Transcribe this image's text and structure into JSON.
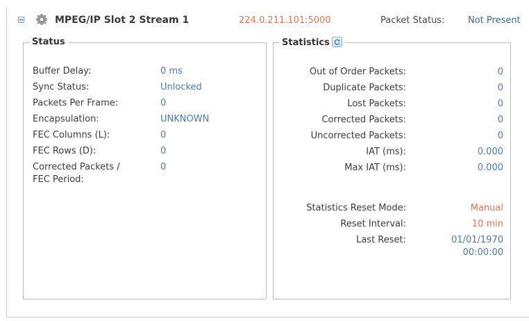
{
  "header": {
    "title": "MPEG/IP Slot 2 Stream 1",
    "address": "224.0.211.101:5000",
    "packet_status_label": "Packet Status:",
    "packet_status_value": "Not Present"
  },
  "status": {
    "legend": "Status",
    "rows": [
      {
        "label": "Buffer Delay:",
        "value": "0 ms"
      },
      {
        "label": "Sync Status:",
        "value": "Unlocked"
      },
      {
        "label": "Packets Per Frame:",
        "value": "0"
      },
      {
        "label": "Encapsulation:",
        "value": "UNKNOWN"
      },
      {
        "label": "FEC Columns (L):",
        "value": "0"
      },
      {
        "label": "FEC Rows (D):",
        "value": "0"
      },
      {
        "label": "Corrected Packets /",
        "label2": "FEC Period:",
        "value": "0"
      }
    ]
  },
  "statistics": {
    "legend": "Statistics",
    "rows": [
      {
        "label": "Out of Order Packets:",
        "value": "0"
      },
      {
        "label": "Duplicate Packets:",
        "value": "0"
      },
      {
        "label": "Lost Packets:",
        "value": "0"
      },
      {
        "label": "Corrected Packets:",
        "value": "0"
      },
      {
        "label": "Uncorrected Packets:",
        "value": "0"
      },
      {
        "label": "IAT (ms):",
        "value": "0.000"
      },
      {
        "label": "Max IAT (ms):",
        "value": "0.000"
      }
    ],
    "reset": {
      "mode_label": "Statistics Reset Mode:",
      "mode_value": "Manual",
      "interval_label": "Reset Interval:",
      "interval_value": "10 min",
      "last_label": "Last Reset:",
      "last_date": "01/01/1970",
      "last_time": "00:00:00"
    }
  },
  "icons": {
    "collapse": "collapse-icon",
    "gear": "gear-icon",
    "refresh": "refresh-icon"
  },
  "colors": {
    "accent_orange": "#e2754f",
    "value_blue": "#4f7ba3",
    "status_blue": "#3b6e98"
  }
}
